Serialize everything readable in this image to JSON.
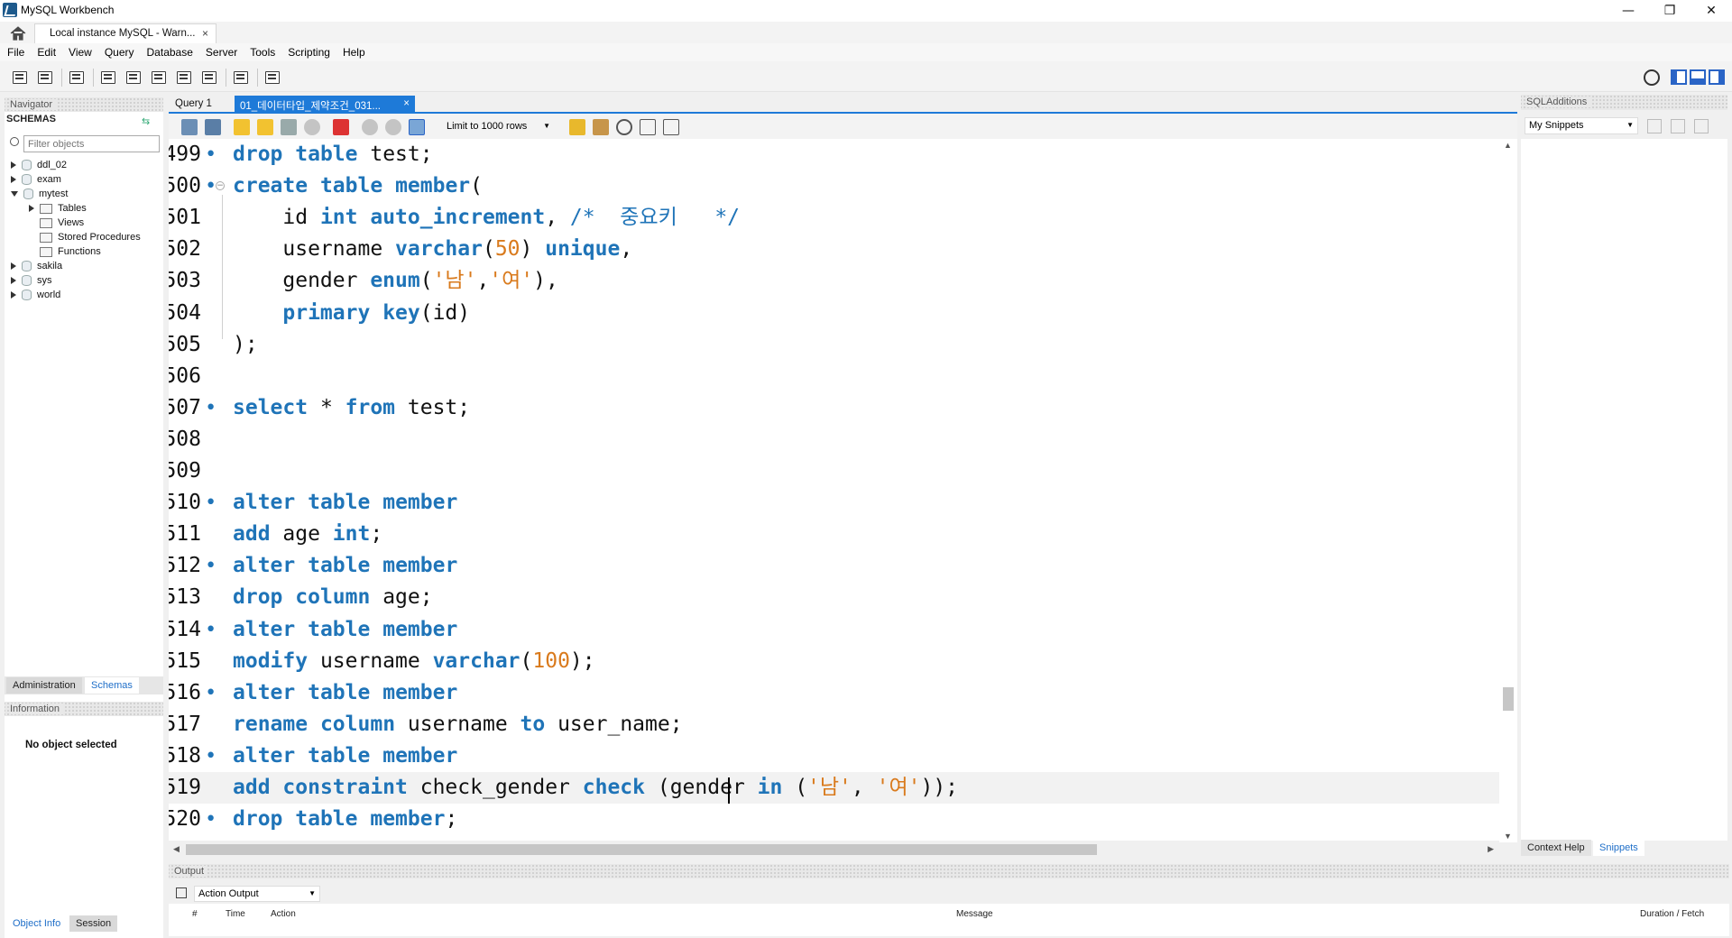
{
  "window": {
    "title": "MySQL Workbench",
    "minimize": "—",
    "maximize": "❐",
    "close": "✕"
  },
  "connection_tab": {
    "label": "Local instance MySQL - Warn...",
    "close": "×"
  },
  "menu": [
    "File",
    "Edit",
    "View",
    "Query",
    "Database",
    "Server",
    "Tools",
    "Scripting",
    "Help"
  ],
  "navigator": {
    "title": "Navigator",
    "schemas_label": "SCHEMAS",
    "filter_placeholder": "Filter objects",
    "tree": [
      {
        "label": "ddl_02",
        "expanded": false,
        "level": 0
      },
      {
        "label": "exam",
        "expanded": false,
        "level": 0
      },
      {
        "label": "mytest",
        "expanded": true,
        "level": 0
      },
      {
        "label": "Tables",
        "expanded": false,
        "level": 1
      },
      {
        "label": "Views",
        "level": 1
      },
      {
        "label": "Stored Procedures",
        "level": 1
      },
      {
        "label": "Functions",
        "level": 1
      },
      {
        "label": "sakila",
        "expanded": false,
        "level": 0
      },
      {
        "label": "sys",
        "expanded": false,
        "level": 0
      },
      {
        "label": "world",
        "expanded": false,
        "level": 0
      }
    ],
    "tabs": {
      "administration": "Administration",
      "schemas": "Schemas"
    },
    "info_title": "Information",
    "no_object": "No object selected",
    "bottom_tabs": {
      "object_info": "Object Info",
      "session": "Session"
    }
  },
  "editor_tabs": {
    "tab1": "Query 1",
    "tab2": "01_데이터타입_제약조건_031..."
  },
  "editor_toolbar": {
    "limit_label": "Limit to 1000 rows"
  },
  "code_lines": [
    {
      "num": "499",
      "dot": true,
      "html": "<span class='kw'>drop</span> <span class='kw'>table</span> test;"
    },
    {
      "num": "500",
      "dot": true,
      "fold": true,
      "html": "<span class='kw'>create</span> <span class='kw'>table</span> <span class='kw'>member</span>("
    },
    {
      "num": "501",
      "dot": false,
      "html": "    id <span class='kw'>int</span> <span class='kw'>auto_increment</span>, <span class='cm'>/*  중요키   */</span>"
    },
    {
      "num": "502",
      "dot": false,
      "html": "    username <span class='kw'>varchar</span>(<span class='num'>50</span>) <span class='kw'>unique</span>,"
    },
    {
      "num": "503",
      "dot": false,
      "html": "    gender <span class='kw'>enum</span>(<span class='str'>'남'</span>,<span class='str'>'여'</span>),"
    },
    {
      "num": "504",
      "dot": false,
      "html": "    <span class='kw'>primary</span> <span class='kw'>key</span>(id)"
    },
    {
      "num": "505",
      "dot": false,
      "html": ");"
    },
    {
      "num": "506",
      "dot": false,
      "html": ""
    },
    {
      "num": "507",
      "dot": true,
      "html": "<span class='kw'>select</span> * <span class='kw'>from</span> test;"
    },
    {
      "num": "508",
      "dot": false,
      "html": ""
    },
    {
      "num": "509",
      "dot": false,
      "html": ""
    },
    {
      "num": "510",
      "dot": true,
      "html": "<span class='kw'>alter</span> <span class='kw'>table</span> <span class='kw'>member</span>"
    },
    {
      "num": "511",
      "dot": false,
      "html": "<span class='kw'>add</span> age <span class='kw'>int</span>;"
    },
    {
      "num": "512",
      "dot": true,
      "html": "<span class='kw'>alter</span> <span class='kw'>table</span> <span class='kw'>member</span>"
    },
    {
      "num": "513",
      "dot": false,
      "html": "<span class='kw'>drop</span> <span class='kw'>column</span> age;"
    },
    {
      "num": "514",
      "dot": true,
      "html": "<span class='kw'>alter</span> <span class='kw'>table</span> <span class='kw'>member</span>"
    },
    {
      "num": "515",
      "dot": false,
      "html": "<span class='kw'>modify</span> username <span class='kw'>varchar</span>(<span class='num'>100</span>);"
    },
    {
      "num": "516",
      "dot": true,
      "html": "<span class='kw'>alter</span> <span class='kw'>table</span> <span class='kw'>member</span>"
    },
    {
      "num": "517",
      "dot": false,
      "html": "<span class='kw'>rename</span> <span class='kw'>column</span> username <span class='kw'>to</span> user_name;"
    },
    {
      "num": "518",
      "dot": true,
      "html": "<span class='kw'>alter</span> <span class='kw'>table</span> <span class='kw'>member</span>"
    },
    {
      "num": "519",
      "dot": false,
      "current": true,
      "html": "<span class='kw'>add</span> <span class='kw'>constraint</span> check_gender <span class='kw'>check</span> (gender <span class='kw'>in</span> (<span class='str'>'남'</span>, <span class='str'>'여'</span>));"
    },
    {
      "num": "520",
      "dot": true,
      "html": "<span class='kw'>drop</span> <span class='kw'>table</span> <span class='kw'>member</span>;"
    }
  ],
  "output": {
    "title": "Output",
    "selector": "Action Output",
    "columns": [
      "#",
      "Time",
      "Action",
      "Message",
      "Duration / Fetch"
    ]
  },
  "sql_additions": {
    "title": "SQLAdditions",
    "snippets_select": "My Snippets",
    "tabs": {
      "context_help": "Context Help",
      "snippets": "Snippets"
    }
  },
  "colors": {
    "accent": "#1e7ad8",
    "keyword": "#1f74b8",
    "string": "#d97a1c"
  }
}
